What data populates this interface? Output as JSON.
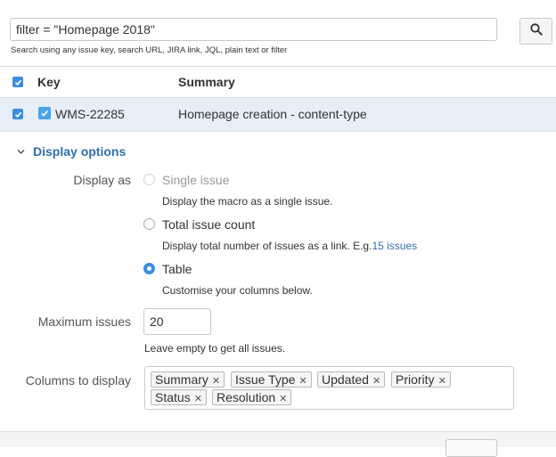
{
  "search": {
    "value": "filter = \"Homepage 2018\"",
    "hint": "Search using any issue key, search URL, JIRA link, JQL, plain text or filter",
    "button_icon": "search-icon"
  },
  "table": {
    "columns": [
      "Key",
      "Summary"
    ],
    "rows": [
      {
        "key": "WMS-22285",
        "summary": "Homepage creation - content-type",
        "selected": true,
        "type_icon": "checkbox-issue-icon"
      }
    ]
  },
  "display_options": {
    "title": "Display options",
    "display_as_label": "Display as",
    "options": [
      {
        "label": "Single issue",
        "description": "Display the macro as a single issue.",
        "state": "disabled"
      },
      {
        "label": "Total issue count",
        "description": "Display total number of issues as a link. E.g.",
        "link": "15 issues",
        "state": "unchecked"
      },
      {
        "label": "Table",
        "description": "Customise your columns below.",
        "state": "checked"
      }
    ],
    "max_issues_label": "Maximum issues",
    "max_issues_value": "20",
    "max_issues_hint": "Leave empty to get all issues.",
    "columns_label": "Columns to display",
    "columns": [
      "Summary",
      "Issue Type",
      "Updated",
      "Priority",
      "Status",
      "Resolution"
    ]
  },
  "colors": {
    "accent": "#3b8ee0",
    "link": "#2f6fae",
    "row_selected": "#e6eef7"
  }
}
